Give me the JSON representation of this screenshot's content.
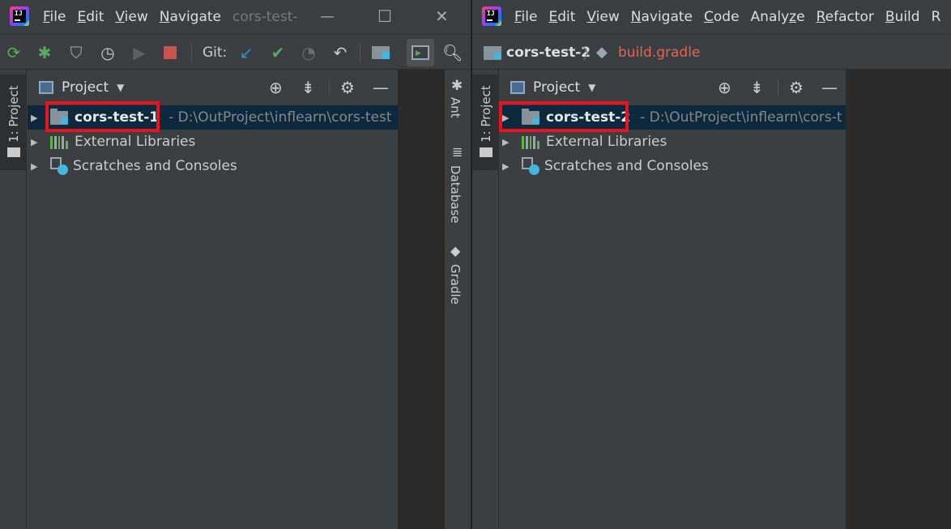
{
  "left_window": {
    "menu": [
      "File",
      "Edit",
      "View",
      "Navigate"
    ],
    "menu_underline": [
      "F",
      "E",
      "V",
      "N"
    ],
    "title_fragment": "cors-test-",
    "toolbar": {
      "git_label": "Git:"
    },
    "panel": {
      "selector_label": "Project",
      "tab_label": "1: Project",
      "tree": [
        {
          "name": "cors-test-1",
          "path": "- D:\\OutProject\\inflearn\\cors-test",
          "bold": true,
          "selected": true
        },
        {
          "name": "External Libraries"
        },
        {
          "name": "Scratches and Consoles"
        }
      ]
    },
    "right_stripe_tabs": [
      "Ant",
      "Database",
      "Gradle"
    ]
  },
  "right_window": {
    "menu": [
      "File",
      "Edit",
      "View",
      "Navigate",
      "Code",
      "Analyze",
      "Refactor",
      "Build",
      "R"
    ],
    "menu_underline": [
      "F",
      "E",
      "V",
      "N",
      "C",
      "z",
      "R",
      "B",
      ""
    ],
    "breadcrumb": {
      "project": "cors-test-2",
      "file": "build.gradle"
    },
    "panel": {
      "selector_label": "Project",
      "tab_label": "1: Project",
      "tree": [
        {
          "name": "cors-test-2",
          "path": "- D:\\OutProject\\inflearn\\cors-t",
          "bold": true,
          "selected": true
        },
        {
          "name": "External Libraries"
        },
        {
          "name": "Scratches and Consoles"
        }
      ]
    }
  },
  "colors": {
    "highlight_box": "#e8131d",
    "selected_row": "#0d293e",
    "file_name_red": "#e36456",
    "run_green": "#59a869",
    "git_blue": "#3592c4"
  }
}
